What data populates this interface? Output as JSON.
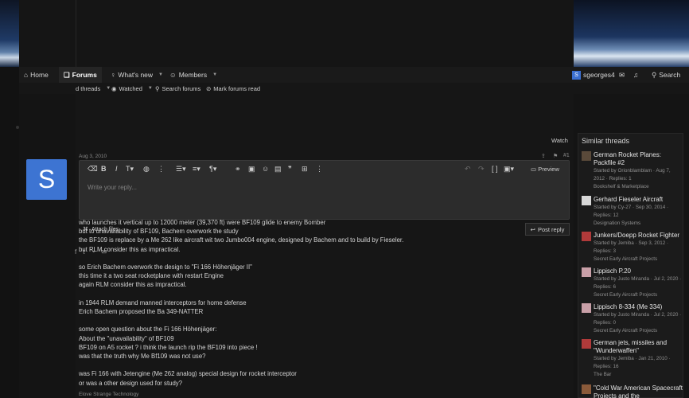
{
  "nav": {
    "home": "Home",
    "forums": "Forums",
    "whats_new": "What's new",
    "members": "Members",
    "username": "sgeorges4",
    "user_initial": "S",
    "search": "Search"
  },
  "subnav": {
    "threads": "d threads",
    "watched": "Watched",
    "search_forums": "Search forums",
    "mark_read": "Mark forums read"
  },
  "thread": {
    "watch": "Watch",
    "post_date": "Aug 3, 2010",
    "post_number": "#1",
    "avatar_initial": "S",
    "editor_placeholder": "Write your reply...",
    "preview": "Preview",
    "post_reply": "Post reply",
    "attach_files": "Attach files",
    "footer": "Elove Strange Technology"
  },
  "post_lines": [
    "who launches it vertical up to 12000 meter (39,370 ft) were BF109 glide to enemy Bomber",
    "but to unavailability of BF109, Bachem overwork the study",
    "the BF109 is replace by a Me 262 like aircraft wit two Jumbo004 engine, designed by Bachem and to build by Fieseler.",
    "but RLM consider this as impractical.",
    "",
    "so Erich Bachem overwork the design to \"Fi 166 Höhenjäger II\"",
    "this time it a two seat rocketplane with restart Engine",
    "again RLM consider this as impractical.",
    "",
    "in 1944 RLM demand manned interceptors for home defense",
    "Erich Bachem proposed the Ba 349-NATTER",
    "",
    "some open question about the Fi 166 Höhenjäger:",
    "About the \"unavailability\" of BF109",
    "BF109 on A5 rocket ? i think the launch rip the BF109 into piece !",
    "was that the truth why Me Bf109 was not use?",
    "",
    "was Fi 166 with Jetengine (Me 262 analog) special design for rocket interceptor",
    "or was a other design used for study?"
  ],
  "similar": {
    "title": "Similar threads",
    "items": [
      {
        "title": "German Rocket Planes: Packfile #2",
        "meta": "Started by Orionblamblam · Aug 7, 2012 · Replies: 1",
        "forum": "Bookshelf & Marketplace",
        "thumb": "#5a4a3a"
      },
      {
        "title": "Gerhard Fieseler Aircraft",
        "meta": "Started by Cy-27 · Sep 30, 2014 · Replies: 12",
        "forum": "Designation Systems",
        "thumb": "#d8d8d8"
      },
      {
        "title": "Junkers/Doepp Rocket Fighter",
        "meta": "Started by Jemiba · Sep 3, 2012 · Replies: 3",
        "forum": "Secret Early Aircraft Projects",
        "thumb": "#b03a3a"
      },
      {
        "title": "Lippisch P.20",
        "meta": "Started by Justo Miranda · Jul 2, 2020 · Replies: 6",
        "forum": "Secret Early Aircraft Projects",
        "thumb": "#c9a0a8"
      },
      {
        "title": "Lippisch 8-334 (Me 334)",
        "meta": "Started by Justo Miranda · Jul 2, 2020 · Replies: 0",
        "forum": "Secret Early Aircraft Projects",
        "thumb": "#c9a0a8"
      },
      {
        "title": "German jets, missiles and \"Wunderwaffen\"",
        "meta": "Started by Jemiba · Jan 21, 2010 · Replies: 16",
        "forum": "The Bar",
        "thumb": "#b03a3a"
      },
      {
        "title": "\"Cold War American Spacecraft Projects and the",
        "meta": "",
        "forum": "",
        "thumb": "#8a5a3a"
      }
    ]
  }
}
